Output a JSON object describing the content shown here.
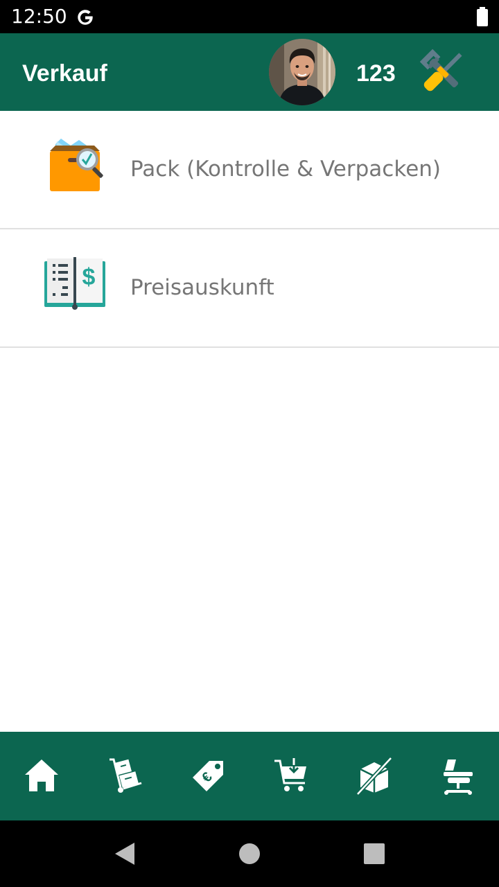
{
  "status_bar": {
    "time": "12:50",
    "icons": [
      "google-g-icon",
      "battery-icon"
    ]
  },
  "app_bar": {
    "title": "Verkauf",
    "user_count": "123",
    "avatar": "user-avatar",
    "settings_icon": "tools-icon"
  },
  "menu": {
    "items": [
      {
        "label": "Pack (Kontrolle & Verpacken)",
        "icon": "box-magnifier-check-icon"
      },
      {
        "label": "Preisauskunft",
        "icon": "price-book-icon"
      }
    ]
  },
  "bottom_nav": {
    "items": [
      {
        "icon": "home-icon"
      },
      {
        "icon": "hand-truck-icon"
      },
      {
        "icon": "price-tag-icon"
      },
      {
        "icon": "cart-download-icon"
      },
      {
        "icon": "box-crossed-icon"
      },
      {
        "icon": "desk-chair-icon"
      }
    ]
  },
  "system_nav": {
    "items": [
      "back-icon",
      "home-circle-icon",
      "recents-icon"
    ]
  },
  "colors": {
    "primary": "#0c6650",
    "status_bar": "#000000",
    "label_text": "#767676",
    "divider": "#e0e0e0",
    "icon_orange": "#ff9800",
    "icon_yellow": "#ffc107",
    "icon_teal": "#26a69a"
  }
}
